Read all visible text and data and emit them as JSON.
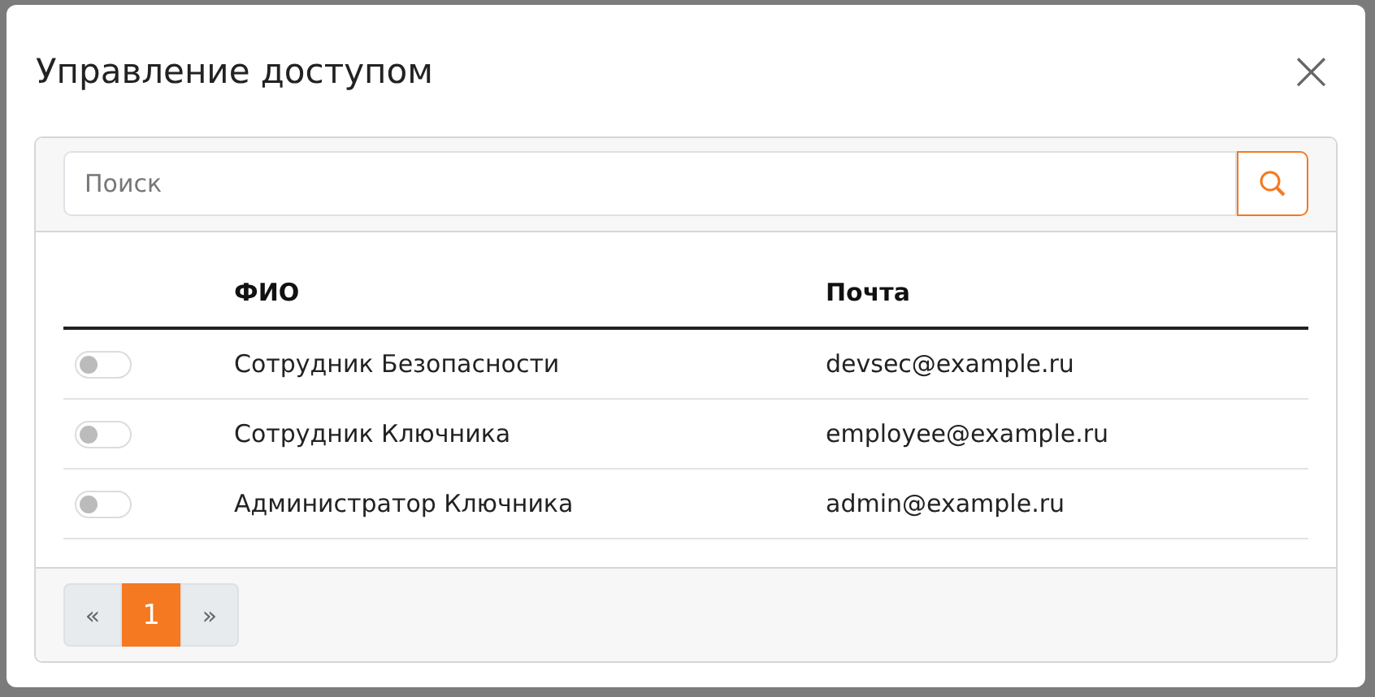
{
  "dialog": {
    "title": "Управление доступом",
    "close": "×"
  },
  "search": {
    "placeholder": "Поиск"
  },
  "table": {
    "columns": [
      {},
      {
        "label": "ФИО"
      },
      {
        "label": "Почта"
      }
    ],
    "rows": [
      {
        "on": false,
        "name": "Сотрудник Безопасности",
        "email": "devsec@example.ru"
      },
      {
        "on": false,
        "name": "Сотрудник Ключника",
        "email": "employee@example.ru"
      },
      {
        "on": false,
        "name": "Администратор Ключника",
        "email": "admin@example.ru"
      }
    ]
  },
  "pagination": [
    {
      "label": "«",
      "selected": false
    },
    {
      "label": "1",
      "selected": true
    },
    {
      "label": "»",
      "selected": false
    }
  ]
}
